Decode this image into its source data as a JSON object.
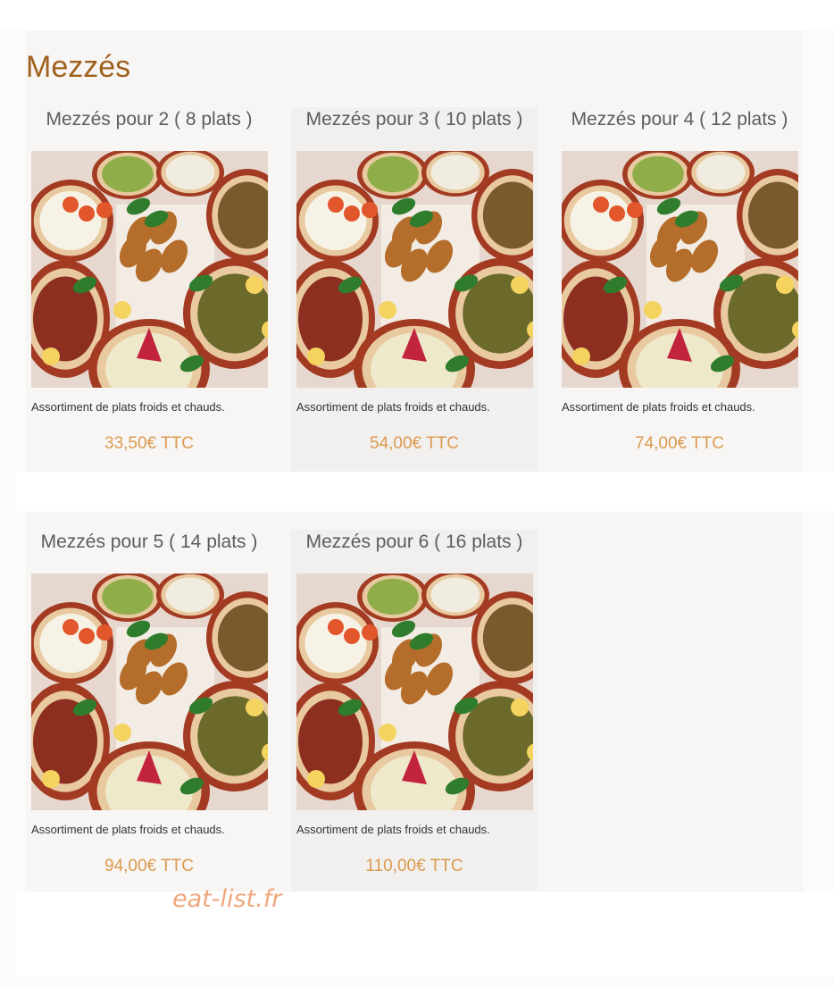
{
  "section": {
    "title": "Mezzés"
  },
  "menu_items": [
    {
      "title": "Mezzés pour 2 ( 8 plats )",
      "description": "Assortiment de plats froids et chauds.",
      "price": "33,50€ TTC"
    },
    {
      "title": "Mezzés pour 3 ( 10 plats )",
      "description": "Assortiment de plats froids et chauds.",
      "price": "54,00€ TTC"
    },
    {
      "title": "Mezzés pour 4 ( 12 plats )",
      "description": "Assortiment de plats froids et chauds.",
      "price": "74,00€ TTC"
    },
    {
      "title": "Mezzés pour 5 ( 14 plats )",
      "description": "Assortiment de plats froids et chauds.",
      "price": "94,00€ TTC"
    },
    {
      "title": "Mezzés pour 6 ( 16 plats )",
      "description": "Assortiment de plats froids et chauds.",
      "price": "110,00€ TTC"
    }
  ],
  "watermark": "eat-list.fr",
  "colors": {
    "section_title": "#a0611e",
    "price": "#dc9a4e",
    "item_title": "#5c5c5c",
    "watermark": "#f0a77c"
  }
}
